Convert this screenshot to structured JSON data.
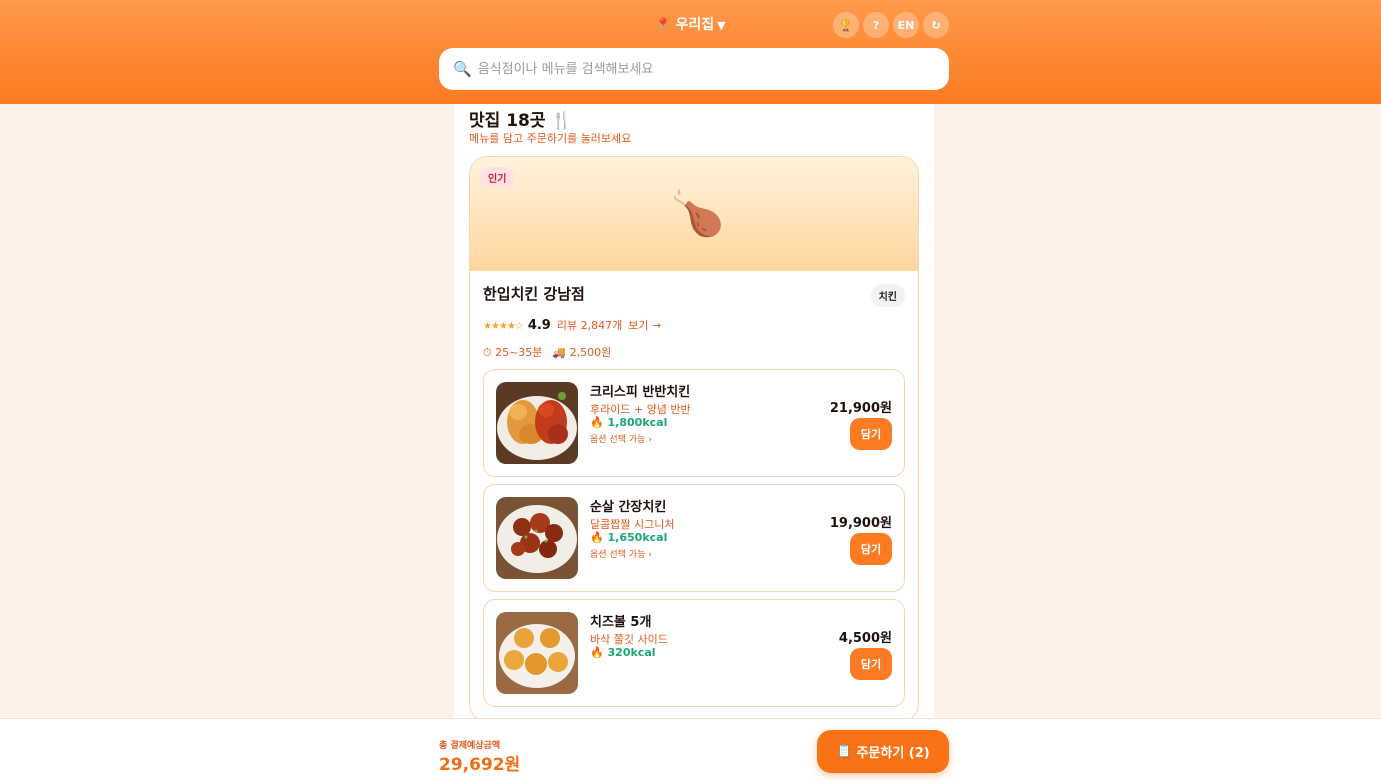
{
  "header": {
    "location_icon": "📍",
    "location": "우리집",
    "location_caret": "▼",
    "buttons": {
      "trophy": "🏆",
      "help": "?",
      "lang": "EN",
      "refresh": "↻"
    },
    "search_icon": "🔍",
    "search_placeholder": "음식점이나 메뉴를 검색해보세요"
  },
  "main": {
    "title": "맛집 18곳 🍴",
    "subtitle": "메뉴를 담고 주문하기를 눌러보세요"
  },
  "restaurant": {
    "badge": "인기",
    "hero_emoji": "🍗",
    "name": "한입치킨 강남점",
    "category": "치킨",
    "stars": "★★★★☆",
    "rating": "4.9",
    "reviews": "리뷰 2,847개",
    "review_link": "보기 →",
    "delivery_time": "⏱ 25~35분",
    "delivery_fee": "🚚 2,500원",
    "menu": [
      {
        "name": "크리스피 반반치킨",
        "desc": "후라이드 + 양념 반반",
        "kcal": "🔥 1,800kcal",
        "option": "옵션 선택 가능 ›",
        "price": "21,900원",
        "button": "담기"
      },
      {
        "name": "순살 간장치킨",
        "desc": "달콤짭짤 시그니처",
        "kcal": "🔥 1,650kcal",
        "option": "옵션 선택 가능 ›",
        "price": "19,900원",
        "button": "담기"
      },
      {
        "name": "치즈볼 5개",
        "desc": "바삭 쫄깃 사이드",
        "kcal": "🔥 320kcal",
        "price": "4,500원",
        "button": "담기"
      }
    ]
  },
  "footer": {
    "total_label": "총 결제예상금액",
    "total_value": "29,692원",
    "order_icon": "📋",
    "order_label": "주문하기 (2)"
  },
  "colors": {
    "brand": "#fb7a22",
    "accent_text": "#e15a1a",
    "kcal": "#18a77a"
  }
}
